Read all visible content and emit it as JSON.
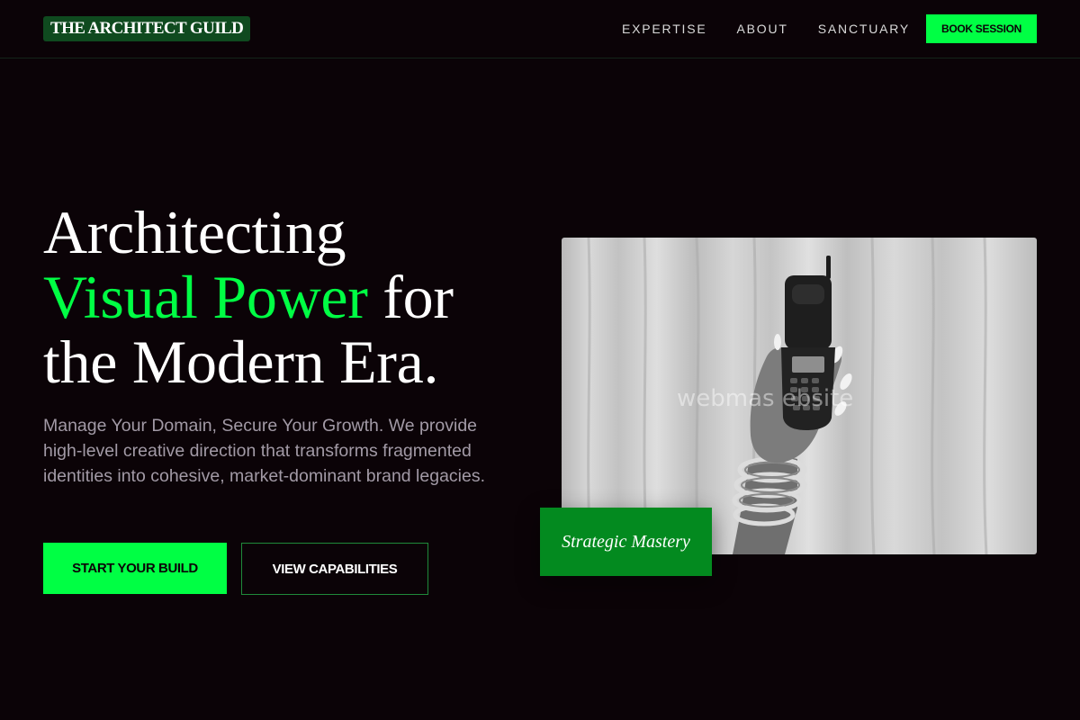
{
  "brand": {
    "name": "THE ARCHITECT GUILD"
  },
  "nav": {
    "items": [
      {
        "label": "EXPERTISE"
      },
      {
        "label": "ABOUT"
      },
      {
        "label": "SANCTUARY"
      }
    ],
    "cta_label": "BOOK SESSION"
  },
  "hero": {
    "title_line1": "Architecting",
    "title_accent": "Visual Power",
    "title_after_accent": " for",
    "title_line3": "the Modern Era.",
    "description": "Manage Your Domain, Secure Your Growth. We provide high-level creative direction that transforms fragmented identities into cohesive, market-dominant brand legacies.",
    "primary_button": "START YOUR BUILD",
    "secondary_button": "VIEW CAPABILITIES"
  },
  "media": {
    "watermark": "webmas         ebsite",
    "badge": "Strategic Mastery"
  },
  "colors": {
    "background": "#0b0307",
    "accent": "#00ff44",
    "accent_dark": "#038a1f",
    "logo_bg": "#0f4a1f"
  }
}
